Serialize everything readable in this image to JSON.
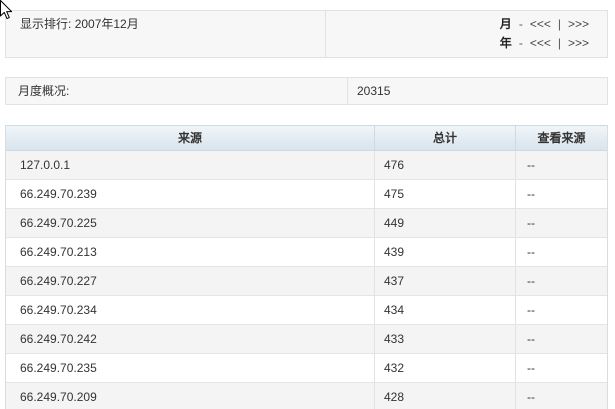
{
  "ranking_panel": {
    "label": "显示排行:",
    "period": "2007年12月",
    "month_nav": {
      "label": "月",
      "dash": "-",
      "prev": "<<<",
      "divider": "|",
      "next": ">>>"
    },
    "year_nav": {
      "label": "年",
      "dash": "-",
      "prev": "<<<",
      "divider": "|",
      "next": ">>>"
    }
  },
  "monthly_overview": {
    "label": "月度概况:",
    "value": "20315"
  },
  "sources_table": {
    "columns": {
      "source": "来源",
      "total": "总计",
      "view_source": "查看来源"
    },
    "rows": [
      {
        "source": "127.0.0.1",
        "total": "476",
        "view": "--"
      },
      {
        "source": "66.249.70.239",
        "total": "475",
        "view": "--"
      },
      {
        "source": "66.249.70.225",
        "total": "449",
        "view": "--"
      },
      {
        "source": "66.249.70.213",
        "total": "439",
        "view": "--"
      },
      {
        "source": "66.249.70.227",
        "total": "437",
        "view": "--"
      },
      {
        "source": "66.249.70.234",
        "total": "434",
        "view": "--"
      },
      {
        "source": "66.249.70.242",
        "total": "433",
        "view": "--"
      },
      {
        "source": "66.249.70.235",
        "total": "432",
        "view": "--"
      },
      {
        "source": "66.249.70.209",
        "total": "428",
        "view": "--"
      }
    ]
  },
  "cursor": {
    "icon": "mouse-pointer-icon"
  }
}
